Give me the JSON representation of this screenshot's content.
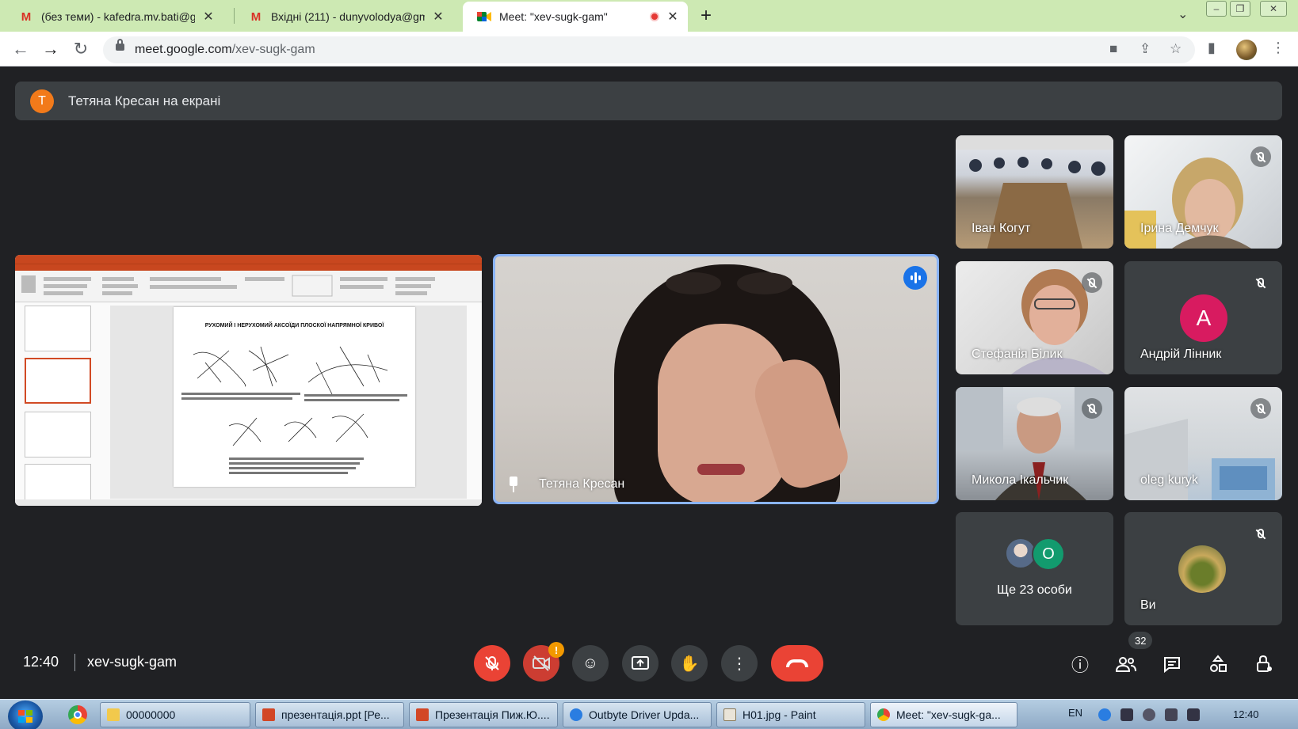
{
  "browser": {
    "tabs": [
      {
        "title": "(без теми) - kafedra.mv.bati@gm",
        "icon": "gmail-icon"
      },
      {
        "title": "Вхідні (211) - dunyvolodya@gma",
        "icon": "gmail-icon"
      },
      {
        "title": "Meet: \"xev-sugk-gam\"",
        "icon": "meet-icon",
        "active": true,
        "recording": true
      }
    ],
    "url_host": "meet.google.com",
    "url_path": "/xev-sugk-gam"
  },
  "banner": {
    "avatar_letter": "T",
    "text": "Тетяна Кресан на екрані"
  },
  "presentation": {
    "slide_heading": "РУХОМИЙ І НЕРУХОМИЙ АКСОЇДИ ПЛОСКОЇ НАПРЯМНОЇ КРИВОЇ"
  },
  "speaker": {
    "name": "Тетяна Кресан",
    "speaking": true
  },
  "participants": [
    {
      "name": "Іван Когут",
      "muted": false
    },
    {
      "name": "Ірина Демчук",
      "muted": true
    },
    {
      "name": "Стефанія Білик",
      "muted": true
    },
    {
      "name": "Андрій Лінник",
      "muted": true,
      "avatar_letter": "A"
    },
    {
      "name": "Микола Ікальчик",
      "muted": true
    },
    {
      "name": "oleg kuryk",
      "muted": true
    }
  ],
  "more_tile": {
    "avatar_letter": "O",
    "text": "Ще 23 особи"
  },
  "self_tile": {
    "name": "Ви",
    "muted": true
  },
  "meeting": {
    "time": "12:40",
    "code": "xev-sugk-gam",
    "participant_count": "32",
    "camera_warning": "!"
  },
  "taskbar": {
    "buttons": [
      {
        "label": "00000000"
      },
      {
        "label": "презентація.ppt [Ре..."
      },
      {
        "label": "Презентація Пиж.Ю...."
      },
      {
        "label": "Outbyte Driver Upda..."
      },
      {
        "label": "H01.jpg - Paint"
      },
      {
        "label": "Meet: \"xev-sugk-ga..."
      }
    ],
    "lang": "EN",
    "clock": "12:40"
  },
  "colors": {
    "meet_bg": "#202124",
    "tile_bg": "#3c4043",
    "accent_blue": "#8ab4f8",
    "end_call_red": "#ea4335",
    "browser_frame": "#cde9b3"
  }
}
